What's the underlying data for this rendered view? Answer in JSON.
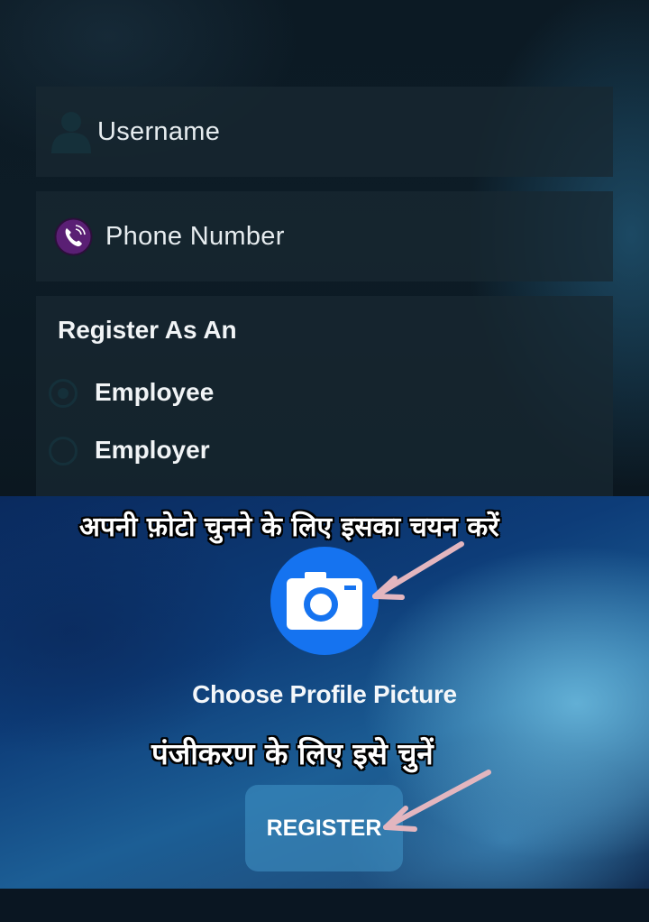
{
  "form": {
    "username_placeholder": "Username",
    "phone_placeholder": "Phone Number",
    "role_heading": "Register As An",
    "role_options": [
      {
        "label": "Employee",
        "selected": true
      },
      {
        "label": "Employer",
        "selected": false
      }
    ]
  },
  "annotations": {
    "photo_hint": "अपनी फ़ोटो चुनने के लिए इसका चयन करें",
    "register_hint": "पंजीकरण के लिए इसे चुनें"
  },
  "profile": {
    "choose_label": "Choose Profile Picture",
    "camera_icon": "camera-icon"
  },
  "actions": {
    "register_label": "REGISTER"
  },
  "colors": {
    "camera_button": "#1573f0",
    "annotation_arrow": "#e3b6bf",
    "phone_icon_bg": "#5a1f74"
  }
}
